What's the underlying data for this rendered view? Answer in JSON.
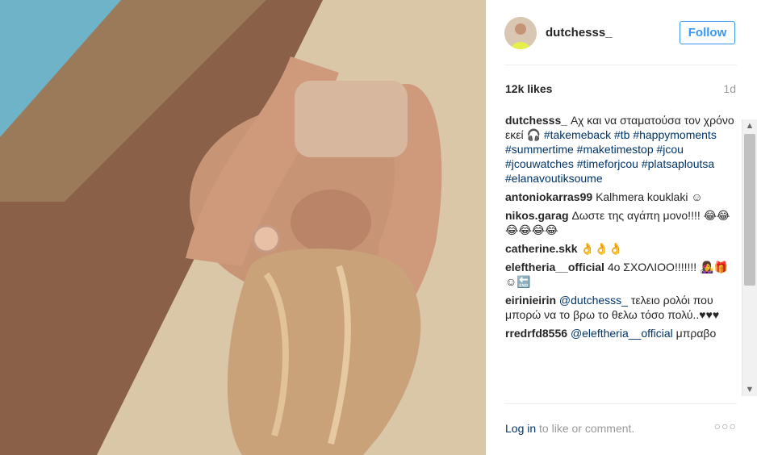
{
  "post": {
    "username": "dutchesss_",
    "follow_label": "Follow",
    "likes": "12k likes",
    "time": "1d",
    "caption_user": "dutchesss_",
    "caption_text": "Αχ και να σταματούσα τον χρόνο εκεί 🎧",
    "caption_tags": "#takemeback #tb #happymoments #summertime #maketimestop #jcou #jcouwatches #timeforjcou #platsaploutsa #elanavoutiksoume"
  },
  "comments": [
    {
      "user": "antoniokarras99",
      "text": "Kalhmera kouklaki ☺"
    },
    {
      "user": "nikos.garag",
      "text": "Δωστε της αγάπη μονο!!!! 😂😂😂😂😂😂"
    },
    {
      "user": "catherine.skk",
      "text": "👌👌👌"
    },
    {
      "user": "eleftheria__official",
      "text": "4ο ΣΧΟΛΙΟΟ!!!!!!! 👩‍🎤🎁☺🔚"
    },
    {
      "user": "eirinieirin",
      "mention": "@dutchesss_",
      "text": "τελειο ρολόι που μπορώ να το βρω το θελω τόσο πολύ..♥♥♥"
    },
    {
      "user": "rredrfd8556",
      "mention": "@eleftheria__official",
      "text": "μπραβο"
    }
  ],
  "footer": {
    "login_label": "Log in",
    "rest_label": "to like or comment.",
    "more_label": "○○○"
  },
  "icons": {
    "scroll_up": "▲",
    "scroll_down": "▼"
  }
}
